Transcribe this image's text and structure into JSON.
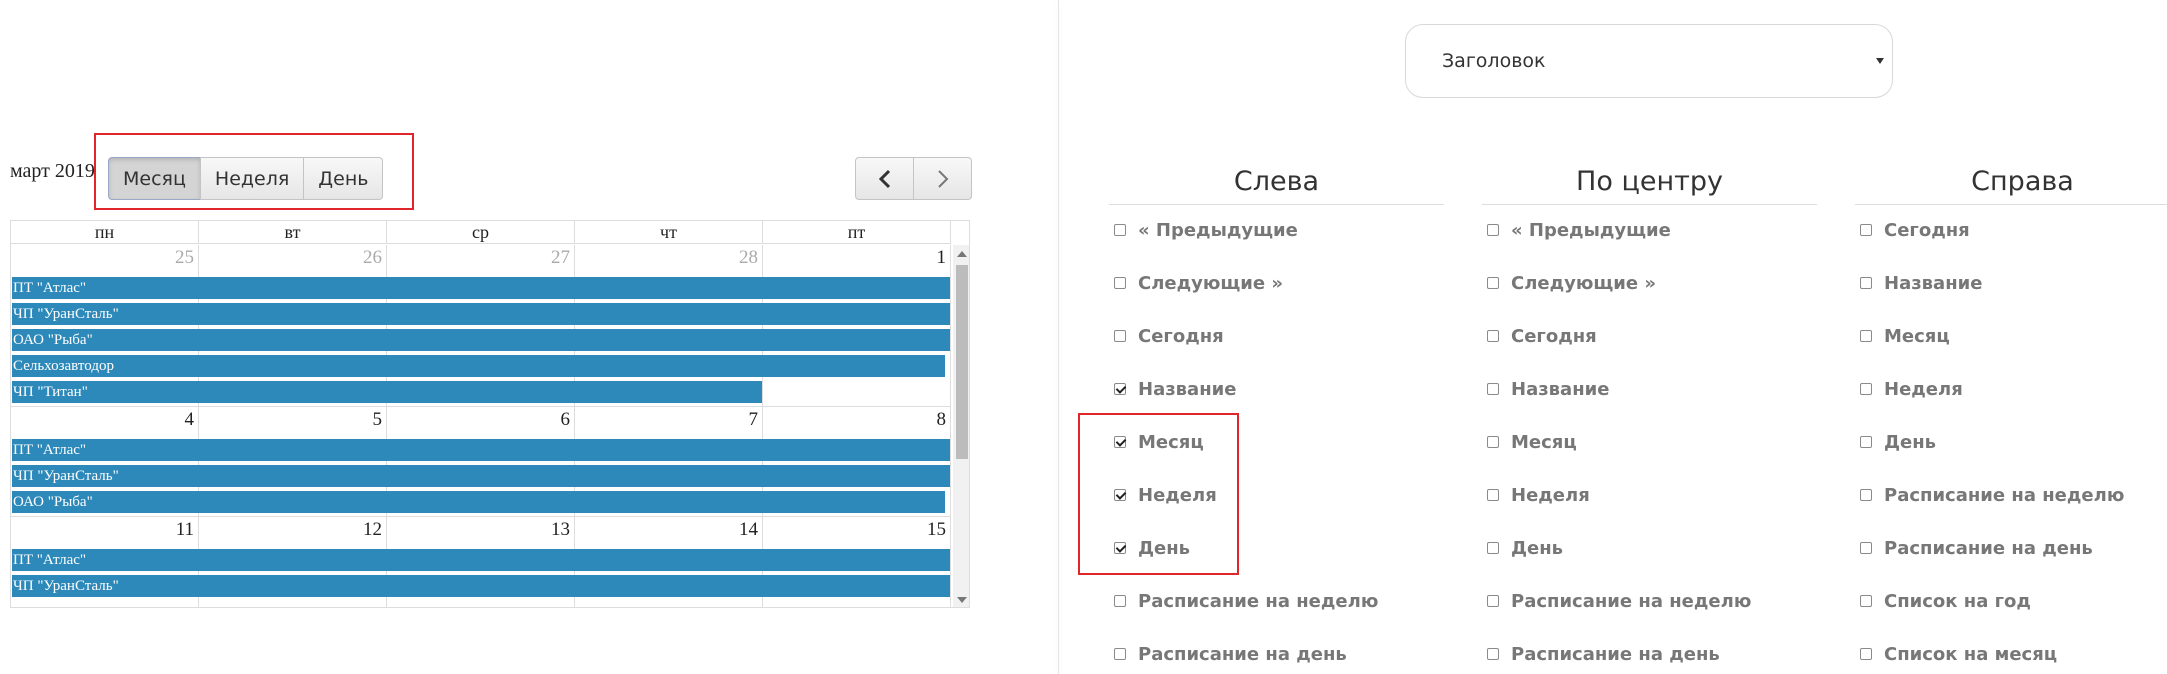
{
  "calendar": {
    "title": "март 2019",
    "views": [
      {
        "label": "Месяц",
        "active": true
      },
      {
        "label": "Неделя",
        "active": false
      },
      {
        "label": "День",
        "active": false
      }
    ],
    "nav": {
      "prev_icon": "chevron-left-icon",
      "next_icon": "chevron-right-icon"
    },
    "day_names": [
      "пн",
      "вт",
      "ср",
      "чт",
      "пт"
    ],
    "weeks": [
      {
        "days": [
          {
            "num": "25",
            "other": true
          },
          {
            "num": "26",
            "other": true
          },
          {
            "num": "27",
            "other": true
          },
          {
            "num": "28",
            "other": true
          },
          {
            "num": "1",
            "other": false
          }
        ],
        "events": [
          {
            "label": "ПТ \"Атлас\"",
            "span": 1.0
          },
          {
            "label": "ЧП \"УранСталь\"",
            "span": 1.0
          },
          {
            "label": "ОАО \"Рыба\"",
            "span": 1.0
          },
          {
            "label": "Сельхозавтодор",
            "span": 0.995
          },
          {
            "label": "ЧП \"Титан\"",
            "span": 0.8
          }
        ]
      },
      {
        "days": [
          {
            "num": "4",
            "other": false
          },
          {
            "num": "5",
            "other": false
          },
          {
            "num": "6",
            "other": false
          },
          {
            "num": "7",
            "other": false
          },
          {
            "num": "8",
            "other": false
          }
        ],
        "events": [
          {
            "label": "ПТ \"Атлас\"",
            "span": 1.0
          },
          {
            "label": "ЧП \"УранСталь\"",
            "span": 1.0
          },
          {
            "label": "ОАО \"Рыба\"",
            "span": 0.995
          }
        ]
      },
      {
        "days": [
          {
            "num": "11",
            "other": false
          },
          {
            "num": "12",
            "other": false
          },
          {
            "num": "13",
            "other": false
          },
          {
            "num": "14",
            "other": false
          },
          {
            "num": "15",
            "other": false
          }
        ],
        "events": [
          {
            "label": "ПТ \"Атлас\"",
            "span": 1.0
          },
          {
            "label": "ЧП \"УранСталь\"",
            "span": 1.0
          }
        ]
      }
    ]
  },
  "header_select": {
    "value": "Заголовок"
  },
  "columns": [
    {
      "title": "Слева",
      "options": [
        {
          "label": "« Предыдущие",
          "checked": false
        },
        {
          "label": "Следующие »",
          "checked": false
        },
        {
          "label": "Сегодня",
          "checked": false
        },
        {
          "label": "Название",
          "checked": true
        },
        {
          "label": "Месяц",
          "checked": true
        },
        {
          "label": "Неделя",
          "checked": true
        },
        {
          "label": "День",
          "checked": true
        },
        {
          "label": "Расписание на неделю",
          "checked": false
        },
        {
          "label": "Расписание на день",
          "checked": false
        }
      ]
    },
    {
      "title": "По центру",
      "options": [
        {
          "label": "« Предыдущие",
          "checked": false
        },
        {
          "label": "Следующие »",
          "checked": false
        },
        {
          "label": "Сегодня",
          "checked": false
        },
        {
          "label": "Название",
          "checked": false
        },
        {
          "label": "Месяц",
          "checked": false
        },
        {
          "label": "Неделя",
          "checked": false
        },
        {
          "label": "День",
          "checked": false
        },
        {
          "label": "Расписание на неделю",
          "checked": false
        },
        {
          "label": "Расписание на день",
          "checked": false
        }
      ]
    },
    {
      "title": "Справа",
      "options": [
        {
          "label": "Сегодня",
          "checked": false
        },
        {
          "label": "Название",
          "checked": false
        },
        {
          "label": "Месяц",
          "checked": false
        },
        {
          "label": "Неделя",
          "checked": false
        },
        {
          "label": "День",
          "checked": false
        },
        {
          "label": "Расписание на неделю",
          "checked": false
        },
        {
          "label": "Расписание на день",
          "checked": false
        },
        {
          "label": "Список на год",
          "checked": false
        },
        {
          "label": "Список на месяц",
          "checked": false
        }
      ]
    }
  ],
  "colors": {
    "event": "#2c89ba",
    "highlight": "#e0262a"
  }
}
